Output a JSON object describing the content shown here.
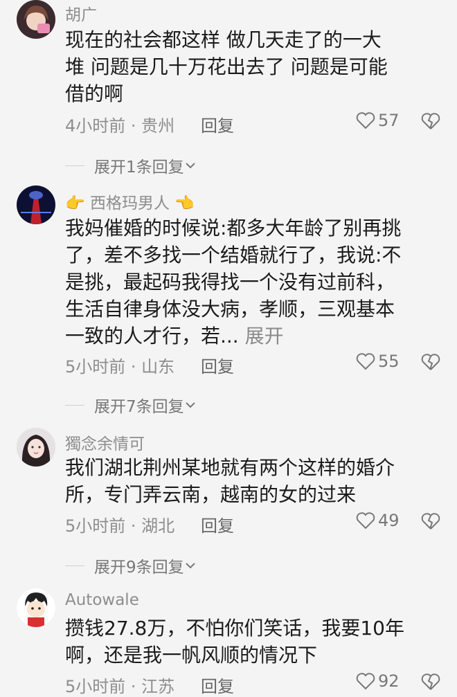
{
  "comments": [
    {
      "name": "胡广",
      "lines": [
        "现在的社会都这样 做几天走了的一大",
        "堆 问题是几十万花出去了 问题是可能",
        "借的啊"
      ],
      "more": "",
      "time": "4小时前 · 贵州",
      "reply": "回复",
      "likes": "57",
      "expand": "展开1条回复"
    },
    {
      "name": "西格玛男人",
      "name_prefix": "👉",
      "name_suffix": "👈",
      "lines": [
        "我妈催婚的时候说:都多大年龄了别再挑",
        "了，差不多找一个结婚就行了，我说:不",
        "是挑，最起码我得找一个没有过前科，",
        "生活自律身体没大病，孝顺，三观基本",
        "一致的人才行，若..."
      ],
      "more": "展开",
      "time": "5小时前 · 山东",
      "reply": "回复",
      "likes": "55",
      "expand": "展开7条回复"
    },
    {
      "name": "獨念余情可",
      "lines": [
        "我们湖北荆州某地就有两个这样的婚介",
        "所，专门弄云南，越南的女的过来"
      ],
      "more": "",
      "time": "5小时前 · 湖北",
      "reply": "回复",
      "likes": "49",
      "expand": "展开9条回复"
    },
    {
      "name": "Autowale",
      "lines": [
        "攒钱27.8万，不怕你们笑话，我要10年",
        "啊，还是我一帆风顺的情况下"
      ],
      "more": "",
      "time": "5小时前 · 江苏",
      "reply": "回复",
      "likes": "92",
      "expand": ""
    }
  ],
  "icons": {
    "like": "heart-outline-icon",
    "dislike": "broken-heart-icon",
    "expand": "chevron-down-icon"
  },
  "colors": {
    "background": "#f4f4f4",
    "meta": "#8d8d8d",
    "text": "#1b1b1b"
  }
}
